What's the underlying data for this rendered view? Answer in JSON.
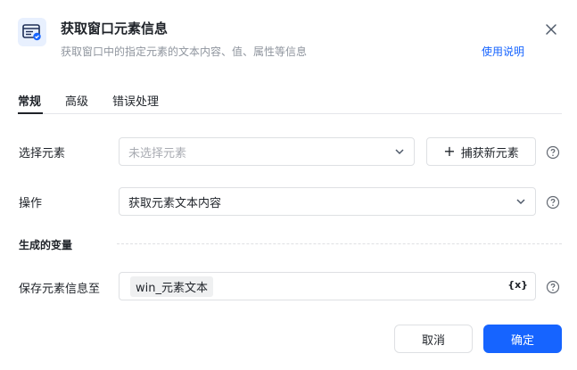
{
  "header": {
    "icon": "window-element-info-icon",
    "title": "获取窗口元素信息",
    "subtitle": "获取窗口中的指定元素的文本内容、值、属性等信息",
    "help_link": "使用说明"
  },
  "tabs": [
    {
      "label": "常规",
      "active": true
    },
    {
      "label": "高级",
      "active": false
    },
    {
      "label": "错误处理",
      "active": false
    }
  ],
  "form": {
    "select_element": {
      "label": "选择元素",
      "placeholder": "未选择元素",
      "capture_button": "捕获新元素"
    },
    "operation": {
      "label": "操作",
      "value": "获取元素文本内容"
    },
    "output_section_title": "生成的变量",
    "save_to": {
      "label": "保存元素信息至",
      "variable": "win_元素文本",
      "var_button": "{x}"
    }
  },
  "footer": {
    "cancel": "取消",
    "confirm": "确定"
  },
  "colors": {
    "accent": "#1664ff",
    "border": "#dee0e3",
    "muted_text": "#8f959e"
  }
}
